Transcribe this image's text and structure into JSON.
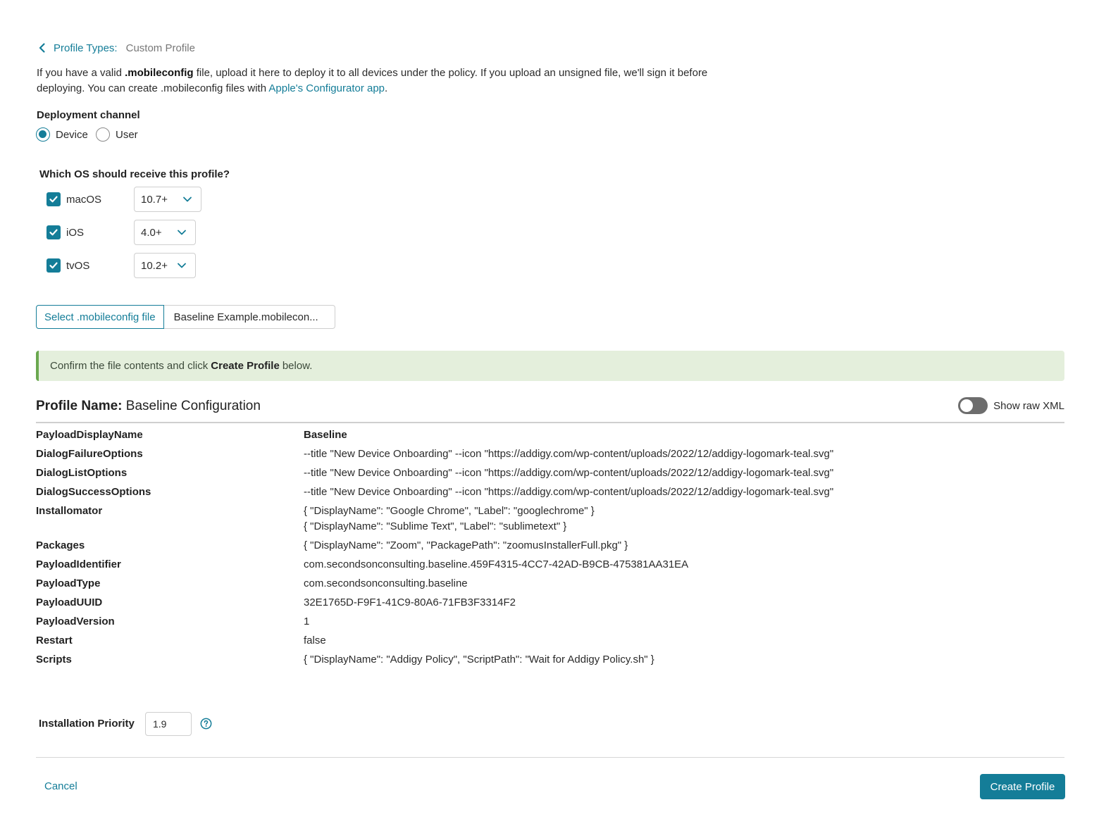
{
  "breadcrumb": {
    "parent": "Profile Types:",
    "current": "Custom Profile"
  },
  "intro": {
    "part1": "If you have a valid ",
    "bold_ext": ".mobileconfig",
    "part2": " file, upload it here to deploy it to all devices under the policy. If you upload an unsigned file, we'll sign it before deploying. You can create .mobileconfig files with ",
    "link": "Apple's Configurator app",
    "part3": "."
  },
  "deployment": {
    "label": "Deployment channel",
    "options": [
      {
        "label": "Device",
        "selected": true
      },
      {
        "label": "User",
        "selected": false
      }
    ]
  },
  "os": {
    "label": "Which OS should receive this profile?",
    "items": [
      {
        "name": "macOS",
        "checked": true,
        "version": "10.7+"
      },
      {
        "name": "iOS",
        "checked": true,
        "version": "4.0+"
      },
      {
        "name": "tvOS",
        "checked": true,
        "version": "10.2+"
      }
    ]
  },
  "file": {
    "select_label": "Select .mobileconfig file",
    "filename": "Baseline Example.mobilecon..."
  },
  "banner": {
    "prefix": "Confirm the file contents and click",
    "bold": "Create Profile",
    "suffix": "below."
  },
  "profile": {
    "name_label": "Profile Name:",
    "name_value": "Baseline Configuration",
    "raw_xml_label": "Show raw XML",
    "raw_xml_on": false
  },
  "payload": [
    {
      "key": "PayloadDisplayName",
      "values": [
        "Baseline"
      ]
    },
    {
      "key": "DialogFailureOptions",
      "values": [
        "--title \"New Device Onboarding\" --icon \"https://addigy.com/wp-content/uploads/2022/12/addigy-logomark-teal.svg\""
      ]
    },
    {
      "key": "DialogListOptions",
      "values": [
        "--title \"New Device Onboarding\" --icon \"https://addigy.com/wp-content/uploads/2022/12/addigy-logomark-teal.svg\""
      ]
    },
    {
      "key": "DialogSuccessOptions",
      "values": [
        "--title \"New Device Onboarding\" --icon \"https://addigy.com/wp-content/uploads/2022/12/addigy-logomark-teal.svg\""
      ]
    },
    {
      "key": "Installomator",
      "values": [
        "{ \"DisplayName\": \"Google Chrome\", \"Label\": \"googlechrome\" }",
        "{ \"DisplayName\": \"Sublime Text\", \"Label\": \"sublimetext\" }"
      ]
    },
    {
      "key": "Packages",
      "values": [
        "{ \"DisplayName\": \"Zoom\", \"PackagePath\": \"zoomusInstallerFull.pkg\" }"
      ]
    },
    {
      "key": "PayloadIdentifier",
      "values": [
        "com.secondsonconsulting.baseline.459F4315-4CC7-42AD-B9CB-475381AA31EA"
      ]
    },
    {
      "key": "PayloadType",
      "values": [
        "com.secondsonconsulting.baseline"
      ]
    },
    {
      "key": "PayloadUUID",
      "values": [
        "32E1765D-F9F1-41C9-80A6-71FB3F3314F2"
      ]
    },
    {
      "key": "PayloadVersion",
      "values": [
        "1"
      ]
    },
    {
      "key": "Restart",
      "values": [
        "false"
      ]
    },
    {
      "key": "Scripts",
      "values": [
        "{ \"DisplayName\": \"Addigy Policy\", \"ScriptPath\": \"Wait for Addigy Policy.sh\" }"
      ]
    }
  ],
  "priority": {
    "label": "Installation Priority",
    "value": "1.9"
  },
  "footer": {
    "cancel": "Cancel",
    "create": "Create Profile"
  },
  "colors": {
    "accent": "#147d98",
    "banner_bg": "#e4efdc",
    "banner_border": "#6aa84f"
  },
  "icons": {
    "back": "chevron-left-icon",
    "check": "check-icon",
    "caret": "chevron-down-icon",
    "help": "help-circle-icon"
  }
}
